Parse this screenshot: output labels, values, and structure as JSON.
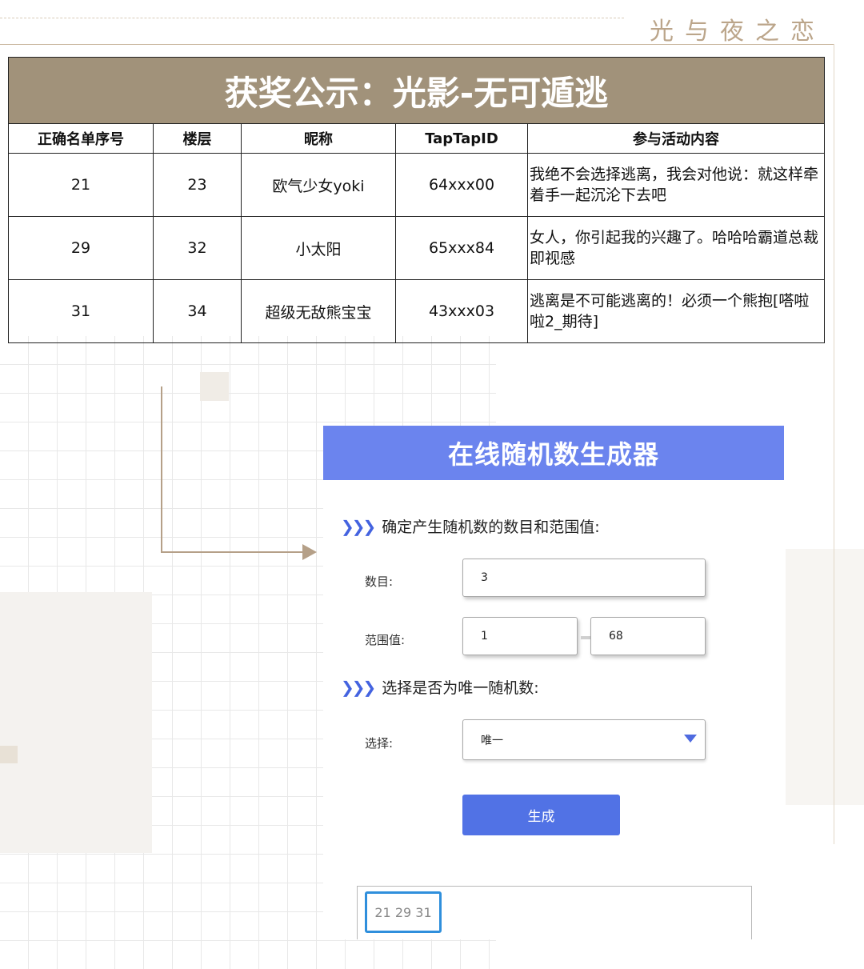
{
  "brand": "光与夜之恋",
  "notice": {
    "title": "获奖公示：光影-无可遁逃",
    "headers": [
      "正确名单序号",
      "楼层",
      "昵称",
      "TapTapID",
      "参与活动内容"
    ],
    "rows": [
      [
        "21",
        "23",
        "欧气少女yoki",
        "64xxx00",
        "我绝不会选择逃离，我会对他说：就这样牵着手一起沉沦下去吧"
      ],
      [
        "29",
        "32",
        "小太阳",
        "65xxx84",
        "女人，你引起我的兴趣了。哈哈哈霸道总裁即视感"
      ],
      [
        "31",
        "34",
        "超级无敌熊宝宝",
        "43xxx03",
        "逃离是不可能逃离的！必须一个熊抱[嗒啦啦2_期待]"
      ]
    ]
  },
  "generator": {
    "title": "在线随机数生成器",
    "section1": "确定产生随机数的数目和范围值:",
    "count_label": "数目:",
    "count_value": "3",
    "range_label": "范围值:",
    "range_min": "1",
    "range_max": "68",
    "section2": "选择是否为唯一随机数:",
    "select_label": "选择:",
    "select_value": "唯一",
    "generate_button": "生成",
    "result": "21 29 31"
  },
  "colors": {
    "table_title_bg": "#a1927a",
    "generator_header_bg": "#6b84ee",
    "button_bg": "#5172e5",
    "accent_brown": "#b5a088"
  }
}
